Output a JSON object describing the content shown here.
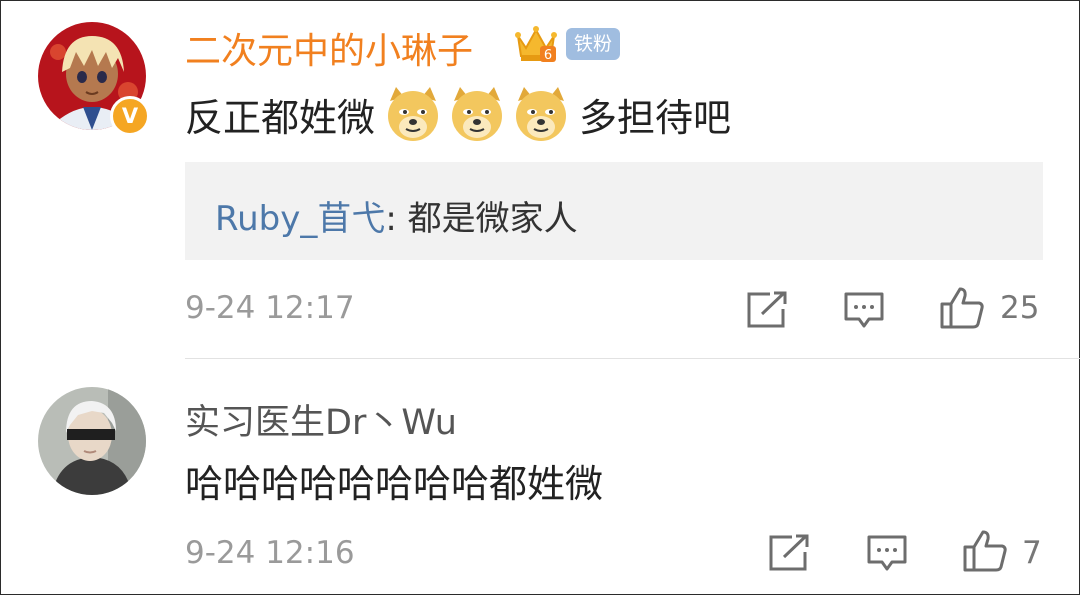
{
  "comments": [
    {
      "username": "二次元中的小琳子",
      "verified_badge": "V",
      "fan_badge": "铁粉",
      "crown_level": "6",
      "content_before": "反正都姓微",
      "emojis": [
        "doge-emoji",
        "doge-emoji",
        "doge-emoji"
      ],
      "content_after": "多担待吧",
      "reply": {
        "user": "Ruby_苜弋",
        "separator": ": ",
        "text": "都是微家人"
      },
      "timestamp": "9-24 12:17",
      "like_count": "25"
    },
    {
      "username": "实习医生Dr丶Wu",
      "content": "哈哈哈哈哈哈哈哈都姓微",
      "timestamp": "9-24 12:16",
      "like_count": "7"
    }
  ],
  "colors": {
    "username_vip": "#f1801f",
    "reply_user": "#4d78a9",
    "fan_badge": "#a0bde0",
    "verified": "#f5a623"
  }
}
